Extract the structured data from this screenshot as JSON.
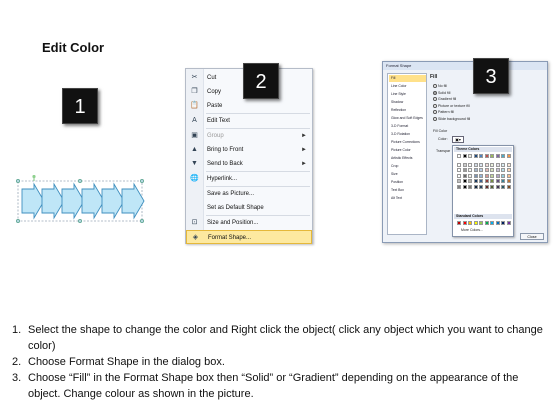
{
  "title": "Edit Color",
  "badges": [
    "1",
    "2",
    "3"
  ],
  "context_menu": {
    "items": [
      {
        "label": "Cut",
        "icon": "scissors-icon",
        "glyph": "✂",
        "arrow": "",
        "disabled": false
      },
      {
        "label": "Copy",
        "icon": "copy-icon",
        "glyph": "❐",
        "arrow": "",
        "disabled": false
      },
      {
        "label": "Paste",
        "icon": "paste-icon",
        "glyph": "📋",
        "arrow": "",
        "disabled": false
      },
      {
        "label": "Edit Text",
        "icon": "edit-text-icon",
        "glyph": "A",
        "arrow": "",
        "disabled": false
      },
      {
        "label": "Group",
        "icon": "group-icon",
        "glyph": "▣",
        "arrow": "►",
        "disabled": true
      },
      {
        "label": "Bring to Front",
        "icon": "bring-front-icon",
        "glyph": "▲",
        "arrow": "►",
        "disabled": false
      },
      {
        "label": "Send to Back",
        "icon": "send-back-icon",
        "glyph": "▼",
        "arrow": "►",
        "disabled": false
      },
      {
        "label": "Hyperlink...",
        "icon": "hyperlink-icon",
        "glyph": "🌐",
        "arrow": "",
        "disabled": false
      },
      {
        "label": "Save as Picture...",
        "icon": "",
        "glyph": "",
        "arrow": "",
        "disabled": false
      },
      {
        "label": "Set as Default Shape",
        "icon": "",
        "glyph": "",
        "arrow": "",
        "disabled": false
      },
      {
        "label": "Size and Position...",
        "icon": "size-position-icon",
        "glyph": "⊡",
        "arrow": "",
        "disabled": false
      },
      {
        "label": "Format Shape...",
        "icon": "format-shape-icon",
        "glyph": "◈",
        "arrow": "",
        "disabled": false,
        "selected": true
      }
    ]
  },
  "format_dialog": {
    "title": "Format Shape",
    "nav": [
      "Fill",
      "Line Color",
      "Line Style",
      "Shadow",
      "Reflection",
      "Glow and Soft Edges",
      "3-D Format",
      "3-D Rotation",
      "Picture Corrections",
      "Picture Color",
      "Artistic Effects",
      "Crop",
      "Size",
      "Position",
      "Text Box",
      "Alt Text"
    ],
    "fill_heading": "Fill",
    "options": [
      "No fill",
      "Solid fill",
      "Gradient fill",
      "Picture or texture fill",
      "Pattern fill",
      "Slide background fill"
    ],
    "selected_option": "Solid fill",
    "fill_color_label": "Fill Color",
    "color_label": "Color:",
    "transparency_label": "Transpar",
    "palette": {
      "theme_header": "Theme Colors",
      "standard_header": "Standard Colors",
      "more_colors": "More Colors...",
      "theme_row": [
        "#ffffff",
        "#000000",
        "#eeece1",
        "#1f497d",
        "#4f81bd",
        "#c0504d",
        "#9bbb59",
        "#8064a2",
        "#4bacc6",
        "#f79646"
      ],
      "standard_row": [
        "#c00000",
        "#ff0000",
        "#ffc000",
        "#ffff00",
        "#92d050",
        "#00b050",
        "#00b0f0",
        "#0070c0",
        "#002060",
        "#7030a0"
      ]
    },
    "close_label": "Close"
  },
  "instructions": [
    {
      "num": "1.",
      "text": "Select the shape to change the color and Right click the object( click any object which you want to change color)"
    },
    {
      "num": "2.",
      "text": "Choose Format Shape in the dialog box."
    },
    {
      "num": "3.",
      "text": "Choose “Fill” in the Format Shape box then “Solid” or “Gradient” depending on the appearance of the object. Change colour as shown in the picture."
    }
  ],
  "colors": {
    "arrow_fill": "#bfe6f7",
    "arrow_stroke": "#3f8fbf",
    "menu_highlight": "#fde9a0"
  }
}
